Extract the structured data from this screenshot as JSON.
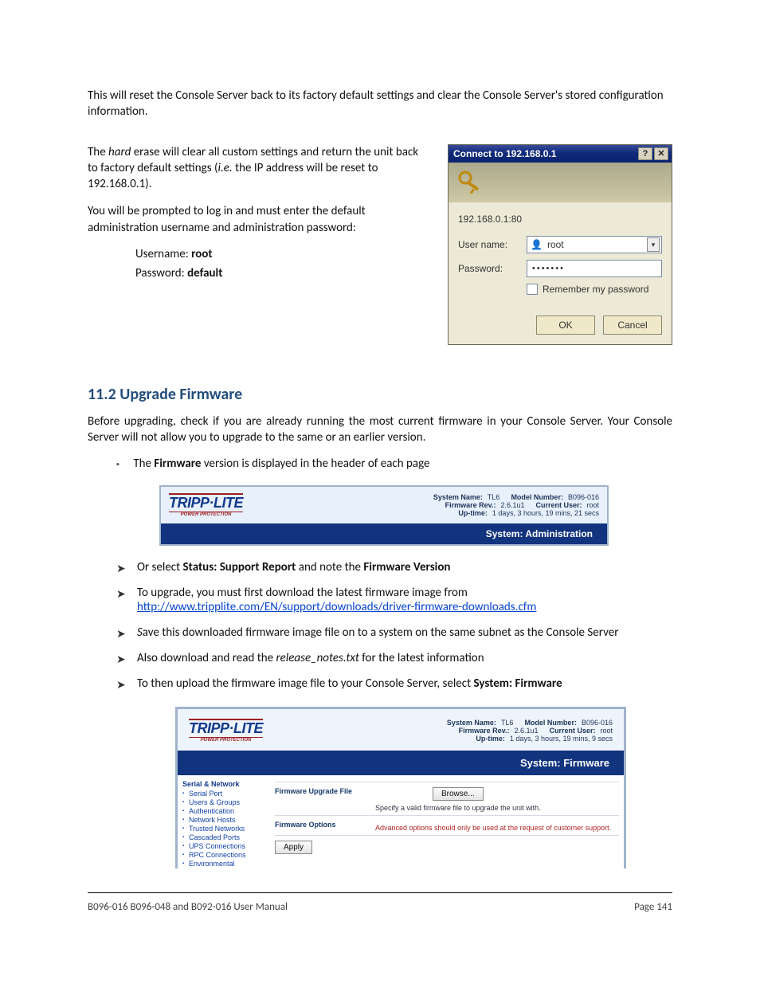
{
  "intro": "This will reset the Console Server back to its factory default settings and clear the Console Server's stored configuration information.",
  "hard_erase": {
    "p1a": "The ",
    "hard": "hard",
    "p1b": " erase will clear all custom settings and return the unit back to factory default settings (",
    "ie": "i.e.",
    "p1c": " the IP address will be reset to 192.168.0.1).",
    "p2": "You will be prompted to log in and must enter the default administration username and administration password:",
    "user_label": "Username: ",
    "user_val": "root",
    "pass_label": "Password: ",
    "pass_val": "default"
  },
  "login_dialog": {
    "title": "Connect to 192.168.0.1",
    "help_btn": "?",
    "close_btn": "✕",
    "addr": "192.168.0.1:80",
    "user_lbl": "User name:",
    "user_val": "root",
    "pass_lbl": "Password:",
    "pass_val": "•••••••",
    "remember": "Remember my password",
    "ok": "OK",
    "cancel": "Cancel"
  },
  "section": {
    "heading": "11.2  Upgrade Firmware",
    "lead": "Before upgrading, check if you are already running the most current firmware in your Console Server. Your Console Server will not allow you to upgrade to the same or an earlier version.",
    "bullet1a": "The ",
    "bullet1b": "Firmware",
    "bullet1c": " version is displayed in the header of each page"
  },
  "banner1": {
    "logo_big": "TRIPP·LITE",
    "logo_small": "POWER PROTECTION",
    "sys_name_k": "System Name:",
    "sys_name_v": "TL6",
    "model_k": "Model Number:",
    "model_v": "B096-016",
    "fw_k": "Firmware Rev.:",
    "fw_v": "2.6.1u1",
    "user_k": "Current User:",
    "user_v": "root",
    "uptime_k": "Up-time:",
    "uptime_v": "1 days, 3 hours, 19 mins, 21 secs",
    "bar": "System: Administration"
  },
  "arrows": {
    "a1a": "Or select ",
    "a1b": "Status: Support Report",
    "a1c": " and note the ",
    "a1d": "Firmware Version",
    "a2": "To upgrade, you must first download the latest firmware image from ",
    "a2_link": "http://www.tripplite.com/EN/support/downloads/driver-firmware-downloads.cfm",
    "a3i": "S",
    "a3": "ave this downloaded firmware image file on to a system on the same subnet as the Console Server",
    "a4a": "Also download and read the ",
    "a4i": "release_notes.txt",
    "a4b": " for the latest information",
    "a5a": "To then upload the firmware image file to your Console Server, select ",
    "a5b": "System: Firmware"
  },
  "banner2": {
    "sys_name_k": "System Name:",
    "sys_name_v": "TL6",
    "model_k": "Model Number:",
    "model_v": "B096-016",
    "fw_k": "Firmware Rev.:",
    "fw_v": "2.6.1u1",
    "user_k": "Current User:",
    "user_v": "root",
    "uptime_k": "Up-time:",
    "uptime_v": "1 days, 3 hours, 19 mins, 9 secs",
    "bar": "System: Firmware",
    "side_header": "Serial & Network",
    "side_items": [
      "Serial Port",
      "Users & Groups",
      "Authentication",
      "Network Hosts",
      "Trusted Networks",
      "Cascaded Ports",
      "UPS Connections",
      "RPC Connections",
      "Environmental"
    ],
    "row1_label": "Firmware Upgrade File",
    "row1_browse": "Browse...",
    "row1_hint": "Specify a valid firmware file to upgrade the unit with.",
    "row2_label": "Firmware Options",
    "row2_note": "Advanced options should only be used at the request of customer support.",
    "apply": "Apply"
  },
  "footer": {
    "left": "B096-016 B096-048 and B092-016 User Manual",
    "right": "Page 141"
  }
}
